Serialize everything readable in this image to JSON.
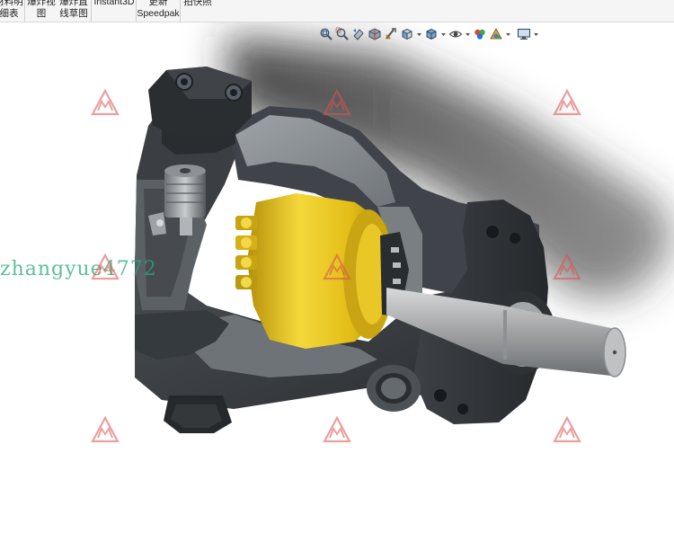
{
  "ribbon": {
    "items": [
      {
        "lines": [
          "材料明",
          "细表"
        ]
      },
      {
        "lines": [
          "爆炸视",
          "图"
        ]
      },
      {
        "lines": [
          "爆炸直",
          "线草图"
        ]
      },
      {
        "lines": [
          "Instant3D"
        ]
      },
      {
        "lines": [
          "更新",
          "Speedpak"
        ]
      },
      {
        "lines": [
          "拍快照"
        ]
      }
    ]
  },
  "view_toolbar": {
    "icons": [
      "zoom-to-fit-icon",
      "zoom-to-area-icon",
      "previous-view-icon",
      "section-view-icon",
      "dynamic-annotation-icon",
      "view-orientation-icon",
      "display-style-icon",
      "hide-show-items-icon",
      "edit-appearance-icon",
      "apply-scene-icon",
      "view-settings-icon"
    ]
  },
  "watermark": {
    "text": "zhangyue4772",
    "logo_mark": "沐风"
  },
  "colors": {
    "body_dark": "#3a3d40",
    "body_mid": "#55595d",
    "cut_face": "#8c9196",
    "gold": "#e6c21a",
    "shaft": "#a9abad",
    "shadow": "#2c2c2c",
    "watermark_green": "#28aa78",
    "logo_red": "#d9534f"
  }
}
